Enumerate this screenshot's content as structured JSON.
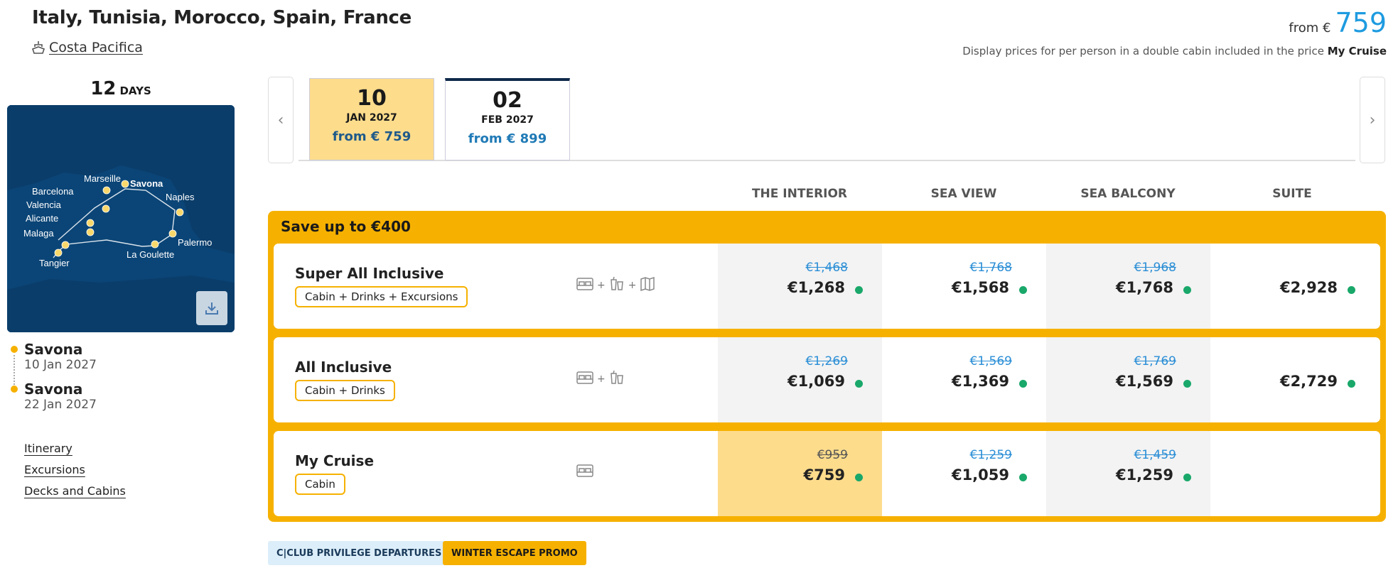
{
  "header": {
    "title": "Italy, Tunisia, Morocco, Spain, France",
    "ship": "Costa Pacifica",
    "from_label": "from €",
    "from_value": "759",
    "display_note_prefix": "Display prices for per person in a double cabin included in the price",
    "display_note_bold": "My Cruise"
  },
  "sidebar": {
    "days_number": "12",
    "days_label": "DAYS",
    "map_labels": [
      "Marseille",
      "Savona",
      "Barcelona",
      "Naples",
      "Valencia",
      "Alicante",
      "Malaga",
      "Palermo",
      "Tangier",
      "La Goulette"
    ],
    "departure": {
      "port": "Savona",
      "date": "10 Jan 2027"
    },
    "arrival": {
      "port": "Savona",
      "date": "22 Jan 2027"
    },
    "links": [
      "Itinerary",
      "Excursions",
      "Decks and Cabins"
    ]
  },
  "date_tabs": [
    {
      "day": "10",
      "month": "JAN 2027",
      "price": "from € 759",
      "selected": true
    },
    {
      "day": "02",
      "month": "FEB 2027",
      "price": "from € 899",
      "selected": false
    }
  ],
  "cabin_types": [
    "THE INTERIOR",
    "SEA VIEW",
    "SEA BALCONY",
    "SUITE"
  ],
  "promo_title": "Save up to €400",
  "packages": [
    {
      "name": "Super All Inclusive",
      "tag": "Cabin + Drinks + Excursions",
      "prices": [
        {
          "old": "€1,468",
          "new": "€1,268"
        },
        {
          "old": "€1,768",
          "new": "€1,568"
        },
        {
          "old": "€1,968",
          "new": "€1,768"
        },
        {
          "old": "",
          "new": "€2,928"
        }
      ]
    },
    {
      "name": "All Inclusive",
      "tag": "Cabin + Drinks",
      "prices": [
        {
          "old": "€1,269",
          "new": "€1,069"
        },
        {
          "old": "€1,569",
          "new": "€1,369"
        },
        {
          "old": "€1,769",
          "new": "€1,569"
        },
        {
          "old": "",
          "new": "€2,729"
        }
      ]
    },
    {
      "name": "My Cruise",
      "tag": "Cabin",
      "prices": [
        {
          "old": "€959",
          "new": "€759"
        },
        {
          "old": "€1,259",
          "new": "€1,059"
        },
        {
          "old": "€1,459",
          "new": "€1,259"
        }
      ]
    }
  ],
  "badges": [
    "C|CLUB PRIVILEGE DEPARTURES",
    "WINTER ESCAPE PROMO"
  ],
  "colors": {
    "accent_yellow": "#f6b100",
    "light_yellow": "#fddc8c",
    "price_blue": "#1e9be0",
    "available_green": "#19a86a"
  }
}
